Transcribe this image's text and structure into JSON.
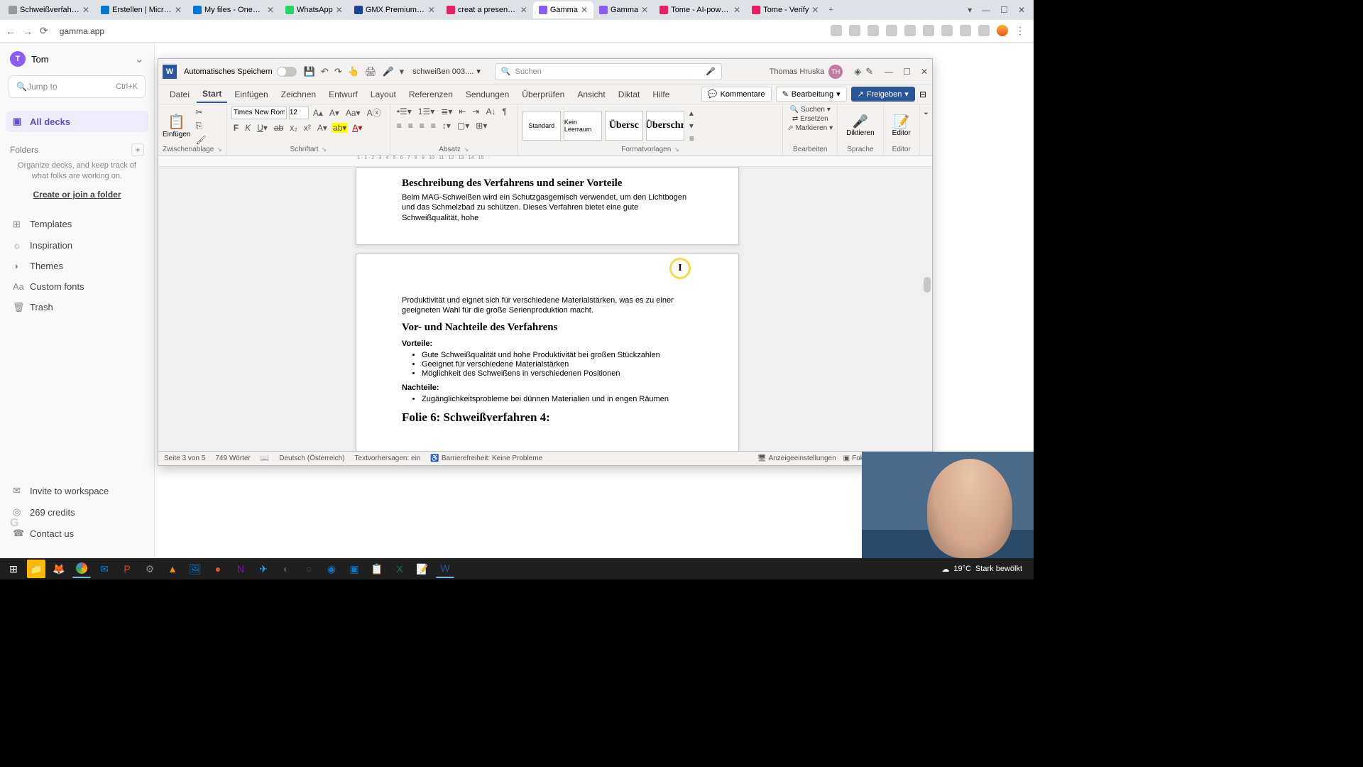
{
  "browser": {
    "url": "gamma.app",
    "tabs": [
      {
        "title": "Schweißverfahren",
        "color": "#999"
      },
      {
        "title": "Erstellen | Microsoft",
        "color": "#0078d4"
      },
      {
        "title": "My files - OneDrive",
        "color": "#0078d4"
      },
      {
        "title": "WhatsApp",
        "color": "#25d366"
      },
      {
        "title": "GMX Premium - E",
        "color": "#1c449b"
      },
      {
        "title": "creat a presentation",
        "color": "#e91e63"
      },
      {
        "title": "Gamma",
        "color": "#8b5cf6",
        "active": true
      },
      {
        "title": "Gamma",
        "color": "#8b5cf6"
      },
      {
        "title": "Tome - AI-powered",
        "color": "#e91e63"
      },
      {
        "title": "Tome - Verify",
        "color": "#e91e63"
      }
    ]
  },
  "gamma": {
    "user": {
      "initial": "T",
      "name": "Tom"
    },
    "jump": {
      "placeholder": "Jump to",
      "shortcut": "Ctrl+K"
    },
    "all_decks": "All decks",
    "folders_hdr": "Folders",
    "folders_hint": "Organize decks, and keep track of what folks are working on.",
    "folders_link": "Create or join a folder",
    "items": [
      {
        "icon": "⊞",
        "label": "Templates"
      },
      {
        "icon": "☼",
        "label": "Inspiration"
      },
      {
        "icon": "◑",
        "label": "Themes"
      },
      {
        "icon": "Aa",
        "label": "Custom fonts"
      },
      {
        "icon": "🗑",
        "label": "Trash"
      }
    ],
    "bottom": [
      {
        "icon": "✉",
        "label": "Invite to workspace"
      },
      {
        "icon": "◎",
        "label": "269 credits"
      },
      {
        "icon": "☎",
        "label": "Contact us"
      }
    ]
  },
  "word": {
    "autosave_label": "Automatisches Speichern",
    "doc_name": "schweißen 003....",
    "search_placeholder": "Suchen",
    "user_name": "Thomas Hruska",
    "user_initials": "TH",
    "ribbon_tabs": [
      "Datei",
      "Start",
      "Einfügen",
      "Zeichnen",
      "Entwurf",
      "Layout",
      "Referenzen",
      "Sendungen",
      "Überprüfen",
      "Ansicht",
      "Diktat",
      "Hilfe"
    ],
    "active_tab": 1,
    "comments": "Kommentare",
    "editing": "Bearbeitung",
    "share": "Freigeben",
    "paste": "Einfügen",
    "clipboard_grp": "Zwischenablage",
    "font_family": "Times New Roman",
    "font_size": "12",
    "font_grp": "Schriftart",
    "para_grp": "Absatz",
    "styles": [
      {
        "label": "Standard"
      },
      {
        "label": "Kein Leerraum"
      },
      {
        "label": "Übersc"
      },
      {
        "label": "Überschr"
      }
    ],
    "styles_grp": "Formatvorlagen",
    "find": "Suchen",
    "replace": "Ersetzen",
    "select": "Markieren",
    "edit_grp": "Bearbeiten",
    "dictate": "Diktieren",
    "dictate_grp": "Sprache",
    "editor_btn": "Editor",
    "editor_grp": "Editor",
    "status": {
      "page": "Seite 3 von 5",
      "words": "749 Wörter",
      "lang": "Deutsch (Österreich)",
      "predictions": "Textvorhersagen: ein",
      "access": "Barrierefreiheit: Keine Probleme",
      "display": "Anzeigeeinstellungen",
      "focus": "Fokus"
    },
    "doc": {
      "h1": "Beschreibung des Verfahrens und seiner Vorteile",
      "p1": "Beim MAG-Schweißen wird ein Schutzgasgemisch verwendet, um den Lichtbogen und das Schmelzbad zu schützen. Dieses Verfahren bietet eine gute Schweißqualität, hohe",
      "p2": "Produktivität und eignet sich für verschiedene Materialstärken, was es zu einer geeigneten Wahl für die große Serienproduktion macht.",
      "h2": "Vor- und Nachteile des Verfahrens",
      "b1": "Vorteile:",
      "li1": "Gute Schweißqualität und hohe Produktivität bei großen Stückzahlen",
      "li2": "Geeignet für verschiedene Materialstärken",
      "li3": "Möglichkeit des Schweißens in verschiedenen Positionen",
      "b2": "Nachteile:",
      "li4": "Zugänglichkeitsprobleme bei dünnen Materialien und in engen Räumen",
      "h3": "Folie 6: Schweißverfahren 4:"
    }
  },
  "weather": {
    "temp": "19°C",
    "cond": "Stark bewölkt"
  }
}
